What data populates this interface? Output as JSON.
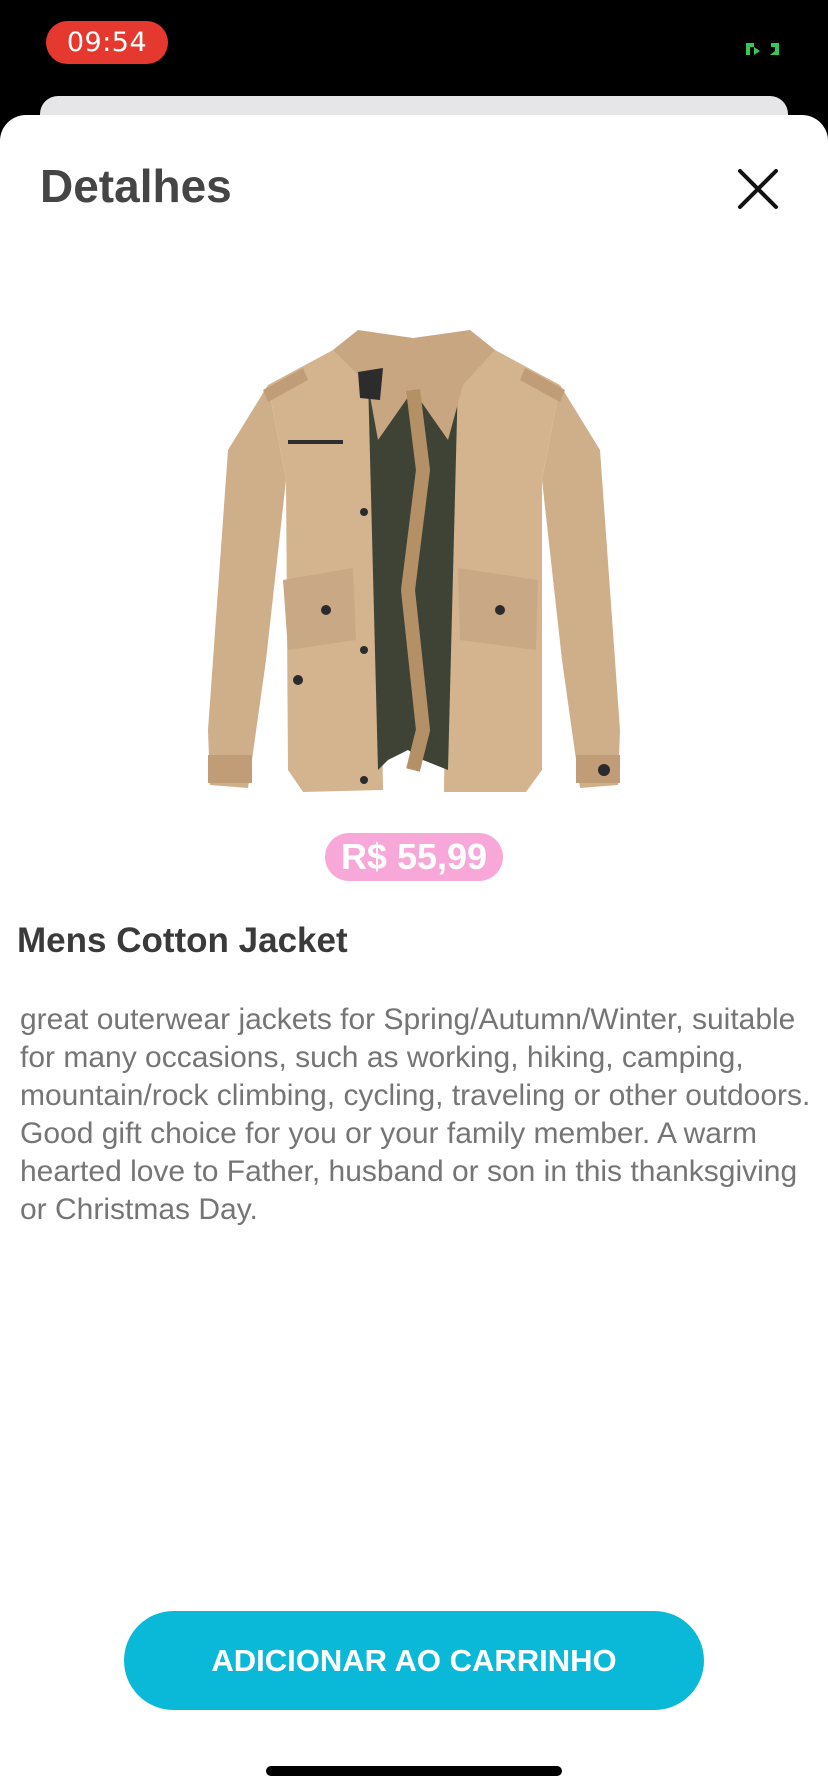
{
  "status_bar": {
    "time": "09:54",
    "time_badge_color": "#e5392f",
    "indicator_icon": "screen-mirroring-icon",
    "indicator_color": "#34c759"
  },
  "modal": {
    "title": "Detalhes",
    "close_icon": "close-icon"
  },
  "product": {
    "image": "jacket-image",
    "price": "R$ 55,99",
    "price_badge_color": "#f7a8d8",
    "name": "Mens Cotton Jacket",
    "description": "great outerwear jackets for Spring/Autumn/Winter, suitable for many occasions, such as working, hiking, camping, mountain/rock climbing, cycling, traveling or other outdoors. Good gift choice for you or your family member. A warm hearted love to Father, husband or son in this thanksgiving or Christmas Day."
  },
  "actions": {
    "add_to_cart_label": "ADICIONAR AO CARRINHO",
    "button_color": "#0ab9d8"
  }
}
